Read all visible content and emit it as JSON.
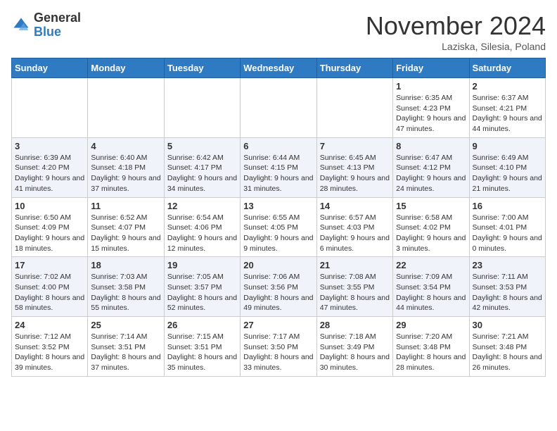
{
  "logo": {
    "general": "General",
    "blue": "Blue"
  },
  "title": "November 2024",
  "subtitle": "Laziska, Silesia, Poland",
  "days_header": [
    "Sunday",
    "Monday",
    "Tuesday",
    "Wednesday",
    "Thursday",
    "Friday",
    "Saturday"
  ],
  "weeks": [
    [
      {
        "day": "",
        "info": ""
      },
      {
        "day": "",
        "info": ""
      },
      {
        "day": "",
        "info": ""
      },
      {
        "day": "",
        "info": ""
      },
      {
        "day": "",
        "info": ""
      },
      {
        "day": "1",
        "info": "Sunrise: 6:35 AM\nSunset: 4:23 PM\nDaylight: 9 hours and 47 minutes."
      },
      {
        "day": "2",
        "info": "Sunrise: 6:37 AM\nSunset: 4:21 PM\nDaylight: 9 hours and 44 minutes."
      }
    ],
    [
      {
        "day": "3",
        "info": "Sunrise: 6:39 AM\nSunset: 4:20 PM\nDaylight: 9 hours and 41 minutes."
      },
      {
        "day": "4",
        "info": "Sunrise: 6:40 AM\nSunset: 4:18 PM\nDaylight: 9 hours and 37 minutes."
      },
      {
        "day": "5",
        "info": "Sunrise: 6:42 AM\nSunset: 4:17 PM\nDaylight: 9 hours and 34 minutes."
      },
      {
        "day": "6",
        "info": "Sunrise: 6:44 AM\nSunset: 4:15 PM\nDaylight: 9 hours and 31 minutes."
      },
      {
        "day": "7",
        "info": "Sunrise: 6:45 AM\nSunset: 4:13 PM\nDaylight: 9 hours and 28 minutes."
      },
      {
        "day": "8",
        "info": "Sunrise: 6:47 AM\nSunset: 4:12 PM\nDaylight: 9 hours and 24 minutes."
      },
      {
        "day": "9",
        "info": "Sunrise: 6:49 AM\nSunset: 4:10 PM\nDaylight: 9 hours and 21 minutes."
      }
    ],
    [
      {
        "day": "10",
        "info": "Sunrise: 6:50 AM\nSunset: 4:09 PM\nDaylight: 9 hours and 18 minutes."
      },
      {
        "day": "11",
        "info": "Sunrise: 6:52 AM\nSunset: 4:07 PM\nDaylight: 9 hours and 15 minutes."
      },
      {
        "day": "12",
        "info": "Sunrise: 6:54 AM\nSunset: 4:06 PM\nDaylight: 9 hours and 12 minutes."
      },
      {
        "day": "13",
        "info": "Sunrise: 6:55 AM\nSunset: 4:05 PM\nDaylight: 9 hours and 9 minutes."
      },
      {
        "day": "14",
        "info": "Sunrise: 6:57 AM\nSunset: 4:03 PM\nDaylight: 9 hours and 6 minutes."
      },
      {
        "day": "15",
        "info": "Sunrise: 6:58 AM\nSunset: 4:02 PM\nDaylight: 9 hours and 3 minutes."
      },
      {
        "day": "16",
        "info": "Sunrise: 7:00 AM\nSunset: 4:01 PM\nDaylight: 9 hours and 0 minutes."
      }
    ],
    [
      {
        "day": "17",
        "info": "Sunrise: 7:02 AM\nSunset: 4:00 PM\nDaylight: 8 hours and 58 minutes."
      },
      {
        "day": "18",
        "info": "Sunrise: 7:03 AM\nSunset: 3:58 PM\nDaylight: 8 hours and 55 minutes."
      },
      {
        "day": "19",
        "info": "Sunrise: 7:05 AM\nSunset: 3:57 PM\nDaylight: 8 hours and 52 minutes."
      },
      {
        "day": "20",
        "info": "Sunrise: 7:06 AM\nSunset: 3:56 PM\nDaylight: 8 hours and 49 minutes."
      },
      {
        "day": "21",
        "info": "Sunrise: 7:08 AM\nSunset: 3:55 PM\nDaylight: 8 hours and 47 minutes."
      },
      {
        "day": "22",
        "info": "Sunrise: 7:09 AM\nSunset: 3:54 PM\nDaylight: 8 hours and 44 minutes."
      },
      {
        "day": "23",
        "info": "Sunrise: 7:11 AM\nSunset: 3:53 PM\nDaylight: 8 hours and 42 minutes."
      }
    ],
    [
      {
        "day": "24",
        "info": "Sunrise: 7:12 AM\nSunset: 3:52 PM\nDaylight: 8 hours and 39 minutes."
      },
      {
        "day": "25",
        "info": "Sunrise: 7:14 AM\nSunset: 3:51 PM\nDaylight: 8 hours and 37 minutes."
      },
      {
        "day": "26",
        "info": "Sunrise: 7:15 AM\nSunset: 3:51 PM\nDaylight: 8 hours and 35 minutes."
      },
      {
        "day": "27",
        "info": "Sunrise: 7:17 AM\nSunset: 3:50 PM\nDaylight: 8 hours and 33 minutes."
      },
      {
        "day": "28",
        "info": "Sunrise: 7:18 AM\nSunset: 3:49 PM\nDaylight: 8 hours and 30 minutes."
      },
      {
        "day": "29",
        "info": "Sunrise: 7:20 AM\nSunset: 3:48 PM\nDaylight: 8 hours and 28 minutes."
      },
      {
        "day": "30",
        "info": "Sunrise: 7:21 AM\nSunset: 3:48 PM\nDaylight: 8 hours and 26 minutes."
      }
    ]
  ]
}
